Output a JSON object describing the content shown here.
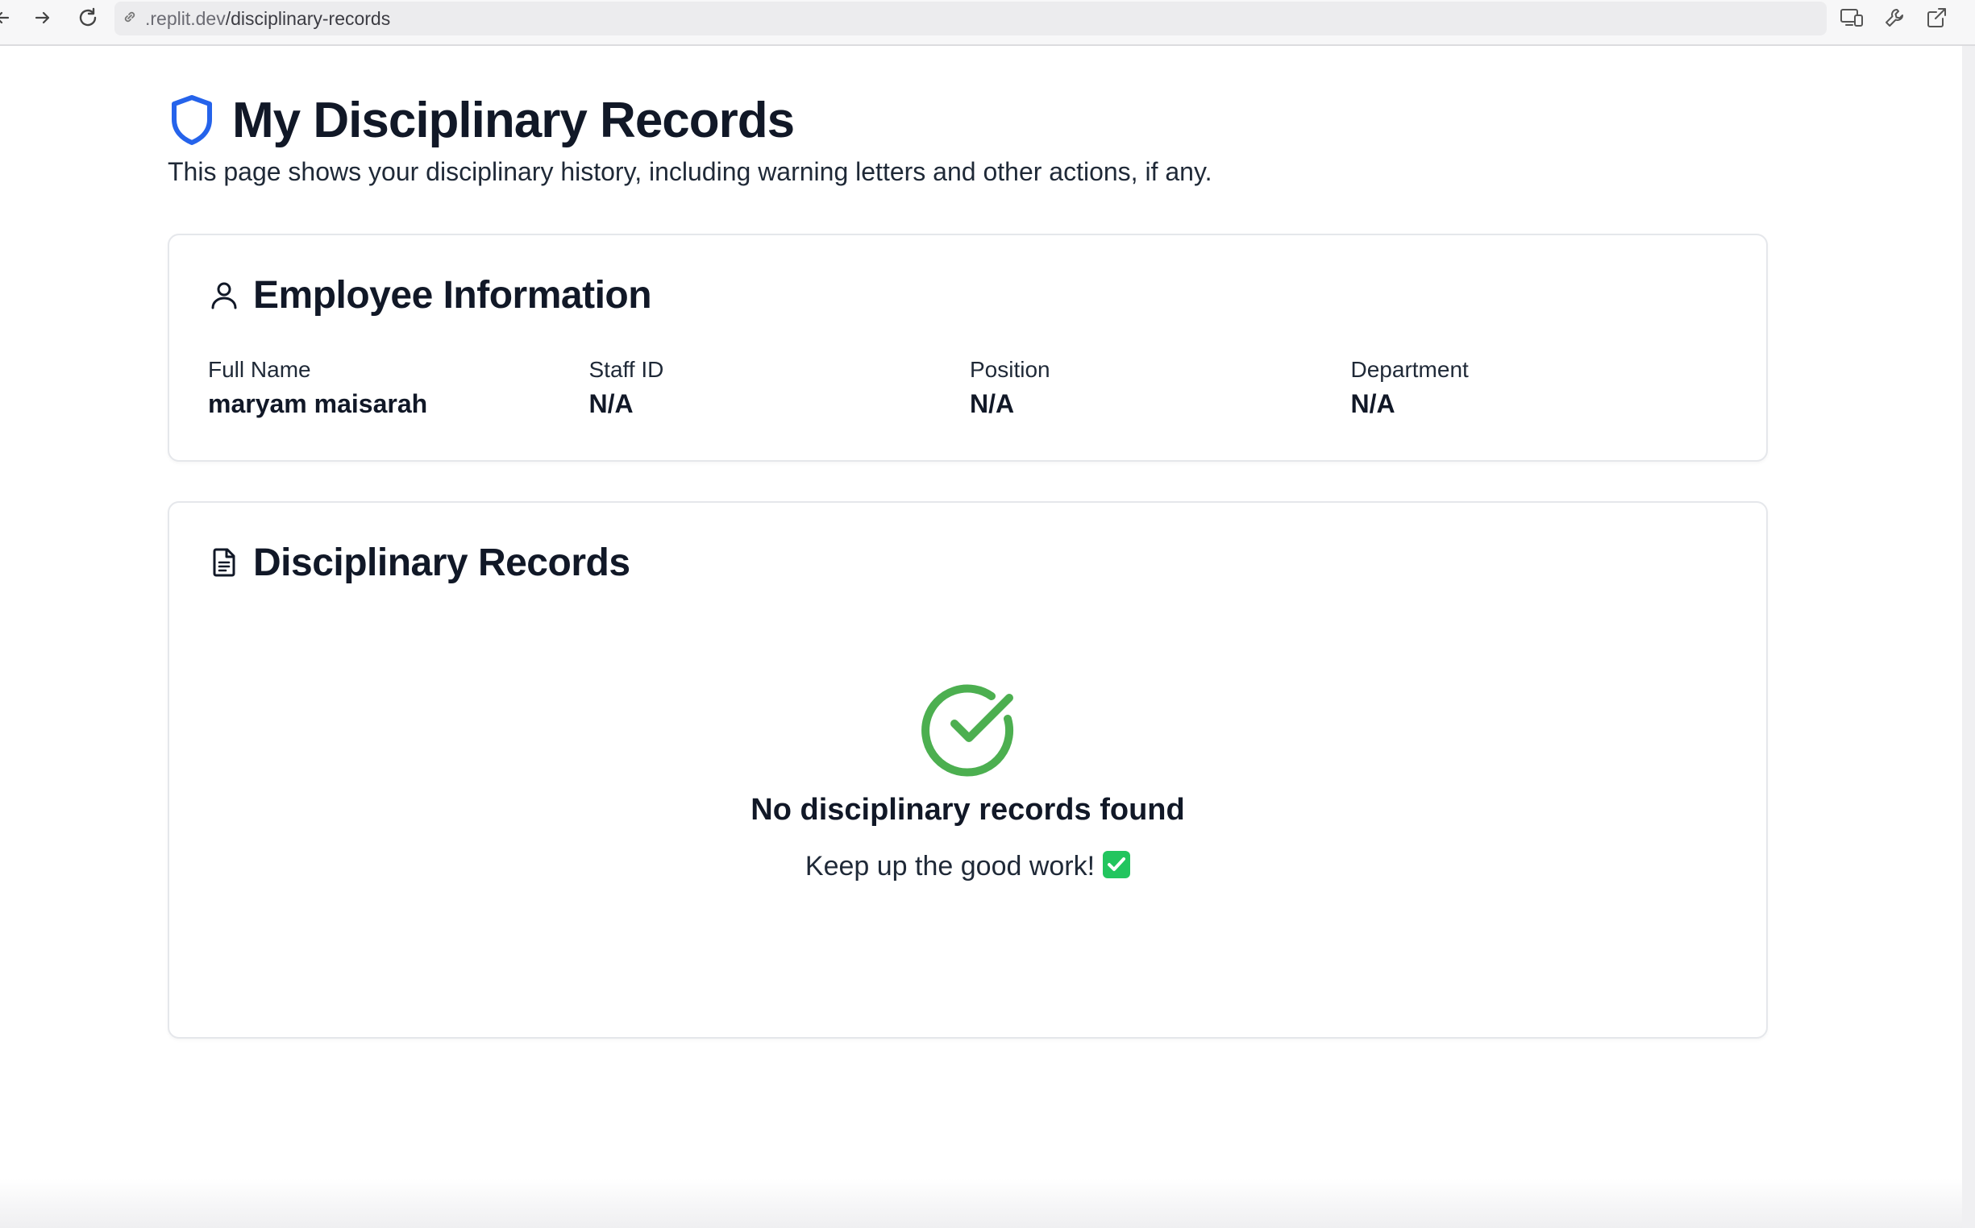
{
  "browser": {
    "url_prefix": ".replit.dev",
    "url_path": "/disciplinary-records",
    "icons": [
      "back-icon",
      "forward-icon",
      "reload-icon",
      "link-icon",
      "devices-icon",
      "wrench-icon",
      "open-external-icon"
    ]
  },
  "header": {
    "title": "My Disciplinary Records",
    "subtitle": "This page shows your disciplinary history, including warning letters and other actions, if any."
  },
  "employee": {
    "section_title": "Employee Information",
    "fields": [
      {
        "label": "Full Name",
        "value": "maryam maisarah"
      },
      {
        "label": "Staff ID",
        "value": "N/A"
      },
      {
        "label": "Position",
        "value": "N/A"
      },
      {
        "label": "Department",
        "value": "N/A"
      }
    ]
  },
  "records": {
    "section_title": "Disciplinary Records",
    "empty_title": "No disciplinary records found",
    "empty_message": "Keep up the good work!"
  },
  "colors": {
    "accent_blue": "#2563eb",
    "success_green": "#4caf50"
  }
}
